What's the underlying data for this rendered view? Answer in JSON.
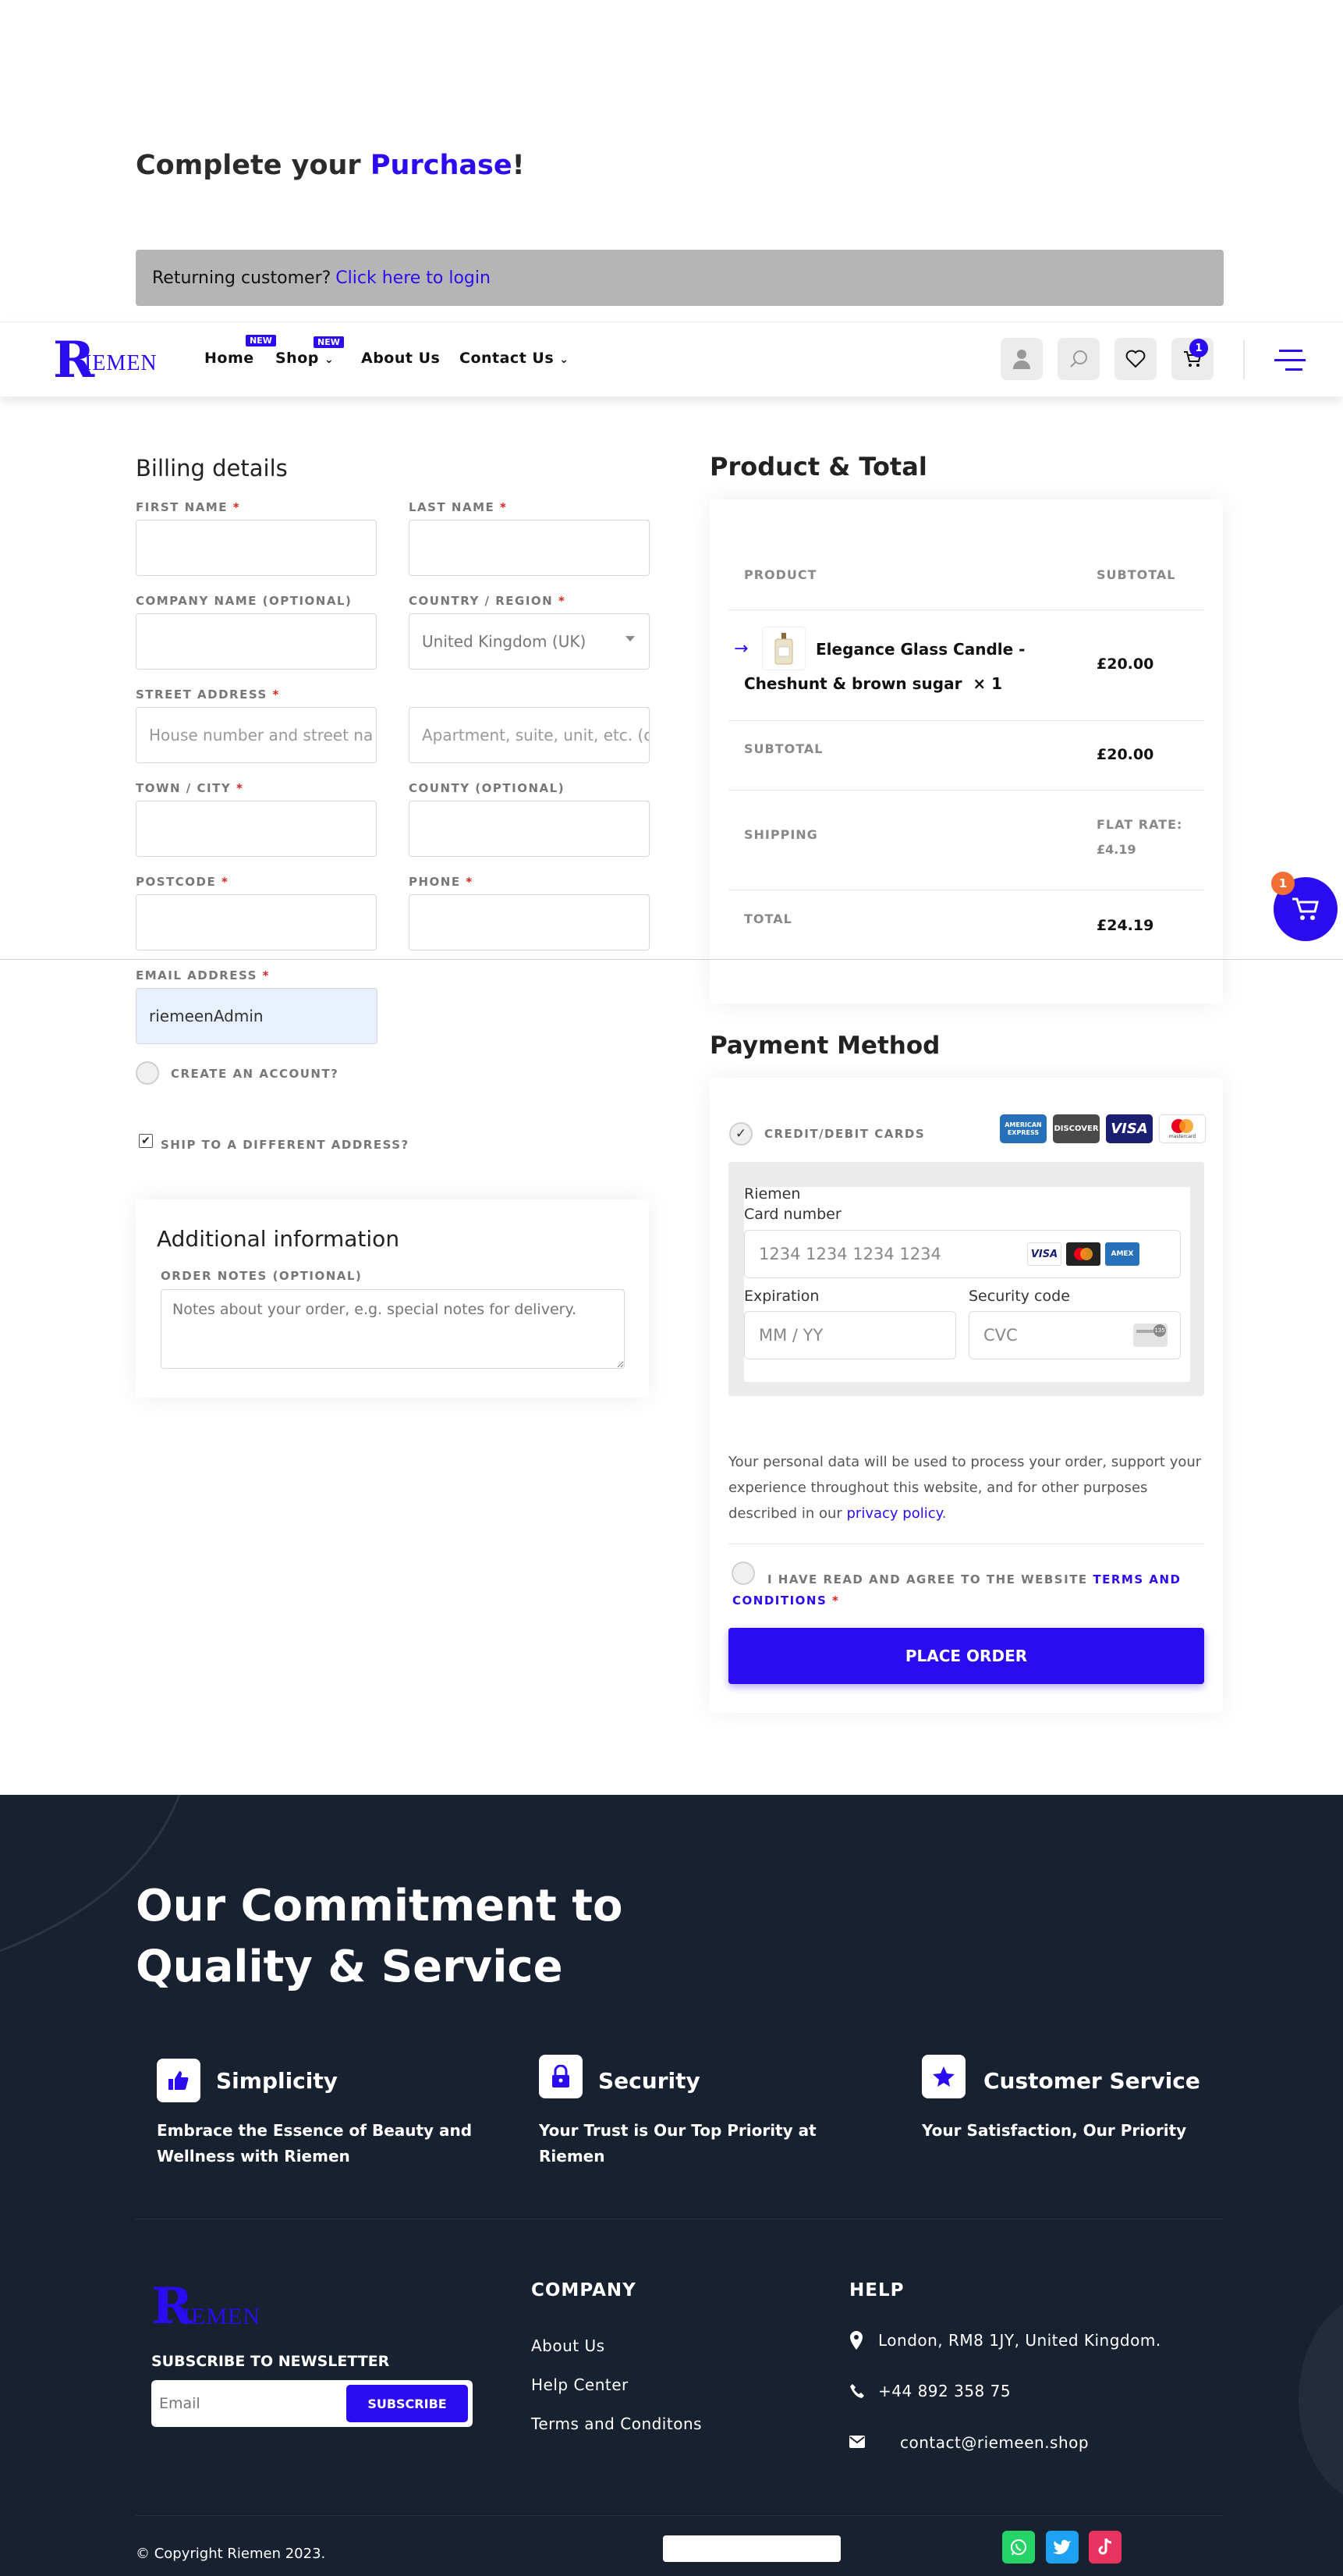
{
  "page": {
    "heading_prefix": "Complete your ",
    "heading_accent": "Purchase",
    "heading_suffix": "!"
  },
  "returning": {
    "text": "Returning customer?",
    "link": "Click here to login"
  },
  "header": {
    "logo_letter": "R",
    "logo_text": "IEMEN",
    "nav": [
      {
        "label": "Home",
        "badge": "NEW"
      },
      {
        "label": "Shop",
        "badge": "NEW"
      },
      {
        "label": "About Us"
      },
      {
        "label": "Contact Us"
      }
    ],
    "cart_count": "1"
  },
  "billing": {
    "title": "Billing details",
    "required_mark": "*",
    "first_name_label": "FIRST NAME",
    "last_name_label": "LAST NAME",
    "company_label": "COMPANY NAME (OPTIONAL)",
    "country_label": "COUNTRY / REGION",
    "country_value": "United Kingdom (UK)",
    "street_label": "STREET ADDRESS",
    "street_placeholder": "House number and street na",
    "street2_placeholder": "Apartment, suite, unit, etc. (o",
    "town_label": "TOWN / CITY",
    "county_label": "COUNTY (OPTIONAL)",
    "postcode_label": "POSTCODE",
    "phone_label": "PHONE",
    "email_label": "EMAIL ADDRESS",
    "email_value": "riemeenAdmin",
    "create_account": "CREATE AN ACCOUNT?",
    "ship_different": "SHIP TO A DIFFERENT ADDRESS?"
  },
  "additional": {
    "title": "Additional information",
    "notes_label": "ORDER NOTES (OPTIONAL)",
    "notes_placeholder": "Notes about your order, e.g. special notes for delivery."
  },
  "order": {
    "title": "Product & Total",
    "col_product": "PRODUCT",
    "col_subtotal": "SUBTOTAL",
    "item_name_line1": "Elegance Glass Candle -",
    "item_name_line2": "Cheshunt & brown sugar",
    "item_qty": "× 1",
    "item_price": "£20.00",
    "subtotal_label": "SUBTOTAL",
    "subtotal_value": "£20.00",
    "shipping_label": "SHIPPING",
    "shipping_value_line1": "FLAT RATE:",
    "shipping_value_line2": "£4.19",
    "total_label": "TOTAL",
    "total_value": "£24.19"
  },
  "payment": {
    "title": "Payment Method",
    "method_label": "CREDIT/DEBIT CARDS",
    "card_logos": [
      "AMERICAN EXPRESS",
      "DISCOVER",
      "VISA",
      "mastercard"
    ],
    "merchant": "Riemen",
    "card_number_label": "Card number",
    "card_number_placeholder": "1234 1234 1234 1234",
    "inline_logos": [
      "VISA",
      "MC",
      "AMEX"
    ],
    "expiration_label": "Expiration",
    "expiration_placeholder": "MM / YY",
    "security_label": "Security code",
    "security_placeholder": "CVC",
    "privacy_text": "Your personal data will be used to process your order, support your experience throughout this website, and for other purposes described in our ",
    "privacy_link": "privacy policy",
    "privacy_end": ".",
    "terms_prefix": "I HAVE READ AND AGREE TO THE WEBSITE ",
    "terms_link_1": "TERMS AND",
    "terms_link_2": "CONDITIONS",
    "place_order": "PLACE ORDER"
  },
  "floating_cart": {
    "count": "1"
  },
  "footer": {
    "title_line1": "Our Commitment to",
    "title_line2": "Quality & Service",
    "features": [
      {
        "title": "Simplicity",
        "desc_line1": "Embrace the Essence of Beauty and",
        "desc_line2": "Wellness with Riemen"
      },
      {
        "title": "Security",
        "desc_line1": "Your Trust is Our Top Priority at",
        "desc_line2": "Riemen"
      },
      {
        "title": "Customer Service",
        "desc_line1": "Your Satisfaction, Our Priority",
        "desc_line2": ""
      }
    ],
    "newsletter_title": "SUBSCRIBE TO NEWSLETTER",
    "email_placeholder": "Email",
    "subscribe": "SUBSCRIBE",
    "company_title": "COMPANY",
    "company_links": [
      "About Us",
      "Help Center",
      "Terms and Conditons"
    ],
    "help_title": "HELP",
    "address": "London, RM8 1JY, United Kingdom.",
    "phone": "+44 892 358 75",
    "email": "contact@riemeen.shop",
    "copyright": "© Copyright Riemen 2023."
  },
  "colors": {
    "accent": "#2b0bf0",
    "footer_bg": "#182130",
    "orange": "#f06f35"
  }
}
